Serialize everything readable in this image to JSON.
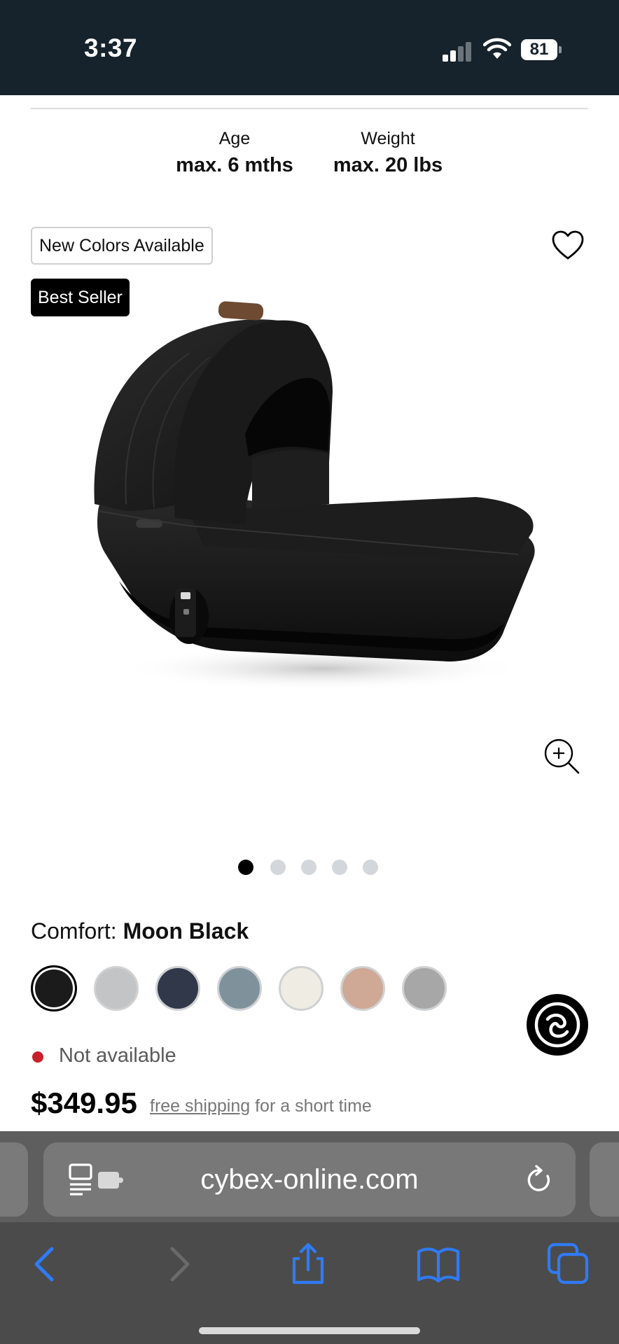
{
  "status_bar": {
    "time": "3:37",
    "battery": "81"
  },
  "specs": {
    "age": {
      "label": "Age",
      "value": "max. 6 mths"
    },
    "weight": {
      "label": "Weight",
      "value": "max. 20 lbs"
    }
  },
  "badges": {
    "new_colors": "New Colors Available",
    "best_seller": "Best Seller"
  },
  "gallery": {
    "total_images": 5,
    "active_index": 0
  },
  "color_selector": {
    "label": "Comfort:",
    "selected_name": "Moon Black",
    "swatches": [
      "#1c1b1b",
      "#c3c4c6",
      "#313849",
      "#7f929c",
      "#efede3",
      "#cfa896",
      "#a7a7a7"
    ],
    "selected_index": 0
  },
  "availability": {
    "text": "Not available",
    "color": "#c8202a"
  },
  "pricing": {
    "price": "$349.95",
    "shipping_link": "free shipping",
    "shipping_suffix": "for a short time"
  },
  "browser": {
    "url": "cybex-online.com",
    "accent": "#2f7bf5"
  }
}
